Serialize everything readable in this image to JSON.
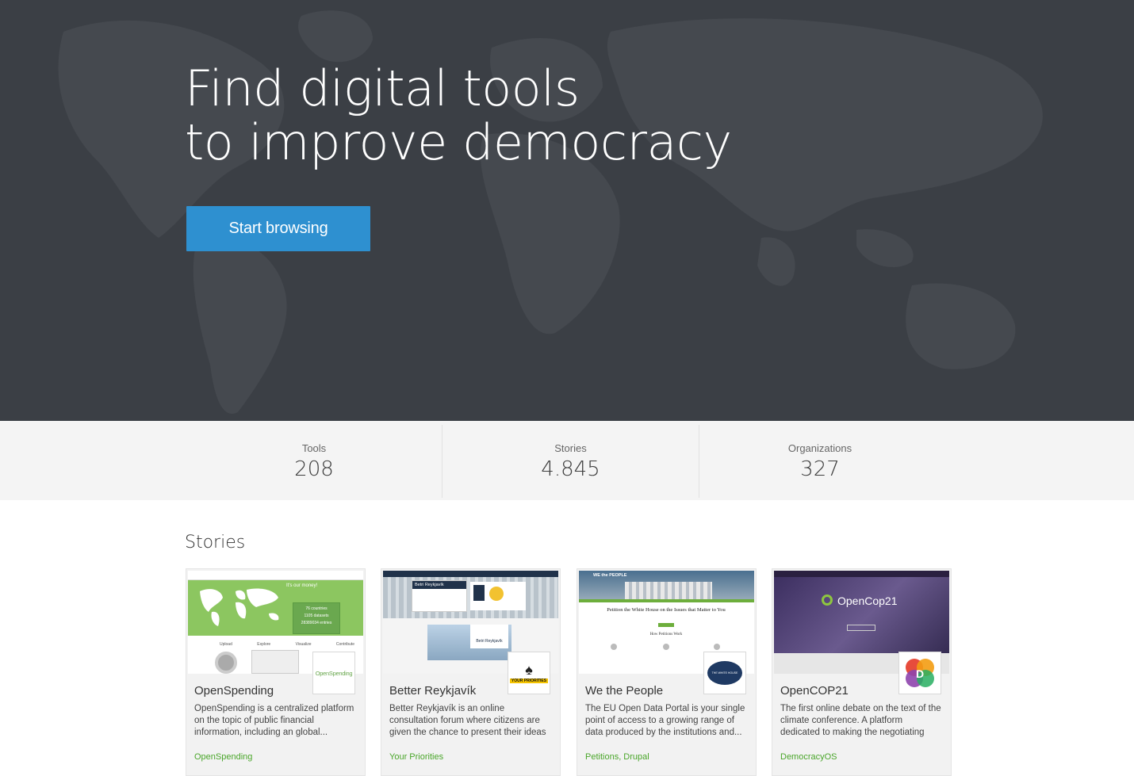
{
  "hero": {
    "title_line1": "Find digital tools",
    "title_line2": "to improve democracy",
    "cta_label": "Start browsing",
    "background_color": "#3b3f45",
    "cta_color": "#2e90d0"
  },
  "stats": [
    {
      "label": "Tools",
      "value": "208"
    },
    {
      "label": "Stories",
      "value": "4.845"
    },
    {
      "label": "Organizations",
      "value": "327"
    }
  ],
  "stories": {
    "title": "Stories",
    "cards": [
      {
        "title": "OpenSpending",
        "description": "OpenSpending is a centralized platform on the topic of public financial information, including an global...",
        "tags": "OpenSpending",
        "logo_text": "OpenSpending",
        "thumb": {
          "headline": "It's our money!",
          "count_countries": "76 countries",
          "count_datasets": "1105 datasets",
          "count_entries": "28389034 entries",
          "menu_upload": "Upload",
          "menu_explore": "Explore",
          "menu_visualize": "Visualize",
          "menu_contribute": "Contribute"
        }
      },
      {
        "title": "Better Reykjavík",
        "description": "Better Reykjavík is an online consultation forum where citizens are given the chance to present their ideas",
        "tags": "Your Priorities",
        "logo_text": "YOUR PRIORITIES",
        "thumb": {
          "headline": "Betri Reykjavík",
          "sub": "Betri Reykjavík"
        }
      },
      {
        "title": "We the People",
        "description": "The EU Open Data Portal is your single point of access to a growing range of data produced by the institutions and...",
        "tags": "Petitions, Drupal",
        "logo_text": "THE WHITE HOUSE",
        "thumb": {
          "brand": "WE the PEOPLE",
          "headline": "Petition the White House on the Issues that Matter to You",
          "sub": "How Petitions Work"
        }
      },
      {
        "title": "OpenCOP21",
        "description": "The first online debate on the text of the climate conference. A platform dedicated to making the negotiating",
        "tags": "DemocracyOS",
        "logo_text": "D",
        "thumb": {
          "brand": "OpenCop21"
        }
      }
    ]
  }
}
